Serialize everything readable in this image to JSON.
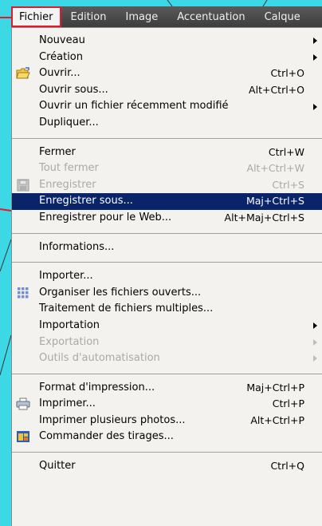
{
  "menubar": {
    "items": [
      {
        "label": "Fichier"
      },
      {
        "label": "Edition"
      },
      {
        "label": "Image"
      },
      {
        "label": "Accentuation"
      },
      {
        "label": "Calque"
      }
    ]
  },
  "menu": {
    "group1": [
      {
        "label": "Nouveau",
        "shortcut": "",
        "submenu": true
      },
      {
        "label": "Création",
        "shortcut": "",
        "submenu": true
      },
      {
        "label": "Ouvrir...",
        "shortcut": "Ctrl+O",
        "icon": "open-folder-icon"
      },
      {
        "label": "Ouvrir sous...",
        "shortcut": "Alt+Ctrl+O"
      },
      {
        "label": "Ouvrir un fichier récemment modifié",
        "shortcut": "",
        "submenu": true
      },
      {
        "label": "Dupliquer...",
        "shortcut": ""
      }
    ],
    "group2": [
      {
        "label": "Fermer",
        "shortcut": "Ctrl+W"
      },
      {
        "label": "Tout fermer",
        "shortcut": "Alt+Ctrl+W",
        "disabled": true
      },
      {
        "label": "Enregistrer",
        "shortcut": "Ctrl+S",
        "disabled": true,
        "icon": "save-disk-icon"
      },
      {
        "label": "Enregistrer sous...",
        "shortcut": "Maj+Ctrl+S",
        "highlighted": true
      },
      {
        "label": "Enregistrer pour le Web...",
        "shortcut": "Alt+Maj+Ctrl+S"
      }
    ],
    "group3": [
      {
        "label": "Informations...",
        "shortcut": ""
      }
    ],
    "group4": [
      {
        "label": "Importer...",
        "shortcut": ""
      },
      {
        "label": "Organiser les fichiers ouverts...",
        "shortcut": "",
        "icon": "grid-organize-icon"
      },
      {
        "label": "Traitement de fichiers multiples...",
        "shortcut": ""
      },
      {
        "label": "Importation",
        "shortcut": "",
        "submenu": true
      },
      {
        "label": "Exportation",
        "shortcut": "",
        "submenu": true,
        "disabled": true
      },
      {
        "label": "Outils d'automatisation",
        "shortcut": "",
        "submenu": true,
        "disabled": true
      }
    ],
    "group5": [
      {
        "label": "Format d'impression...",
        "shortcut": "Maj+Ctrl+P"
      },
      {
        "label": "Imprimer...",
        "shortcut": "Ctrl+P",
        "icon": "printer-icon"
      },
      {
        "label": "Imprimer plusieurs photos...",
        "shortcut": "Alt+Ctrl+P"
      },
      {
        "label": "Commander des tirages...",
        "shortcut": "",
        "icon": "order-prints-icon"
      }
    ],
    "group6": [
      {
        "label": "Quitter",
        "shortcut": "Ctrl+Q"
      }
    ]
  },
  "colors": {
    "highlight": "#0a246a",
    "annotation_arrow": "#e8162b",
    "background": "#3dd8e6"
  }
}
